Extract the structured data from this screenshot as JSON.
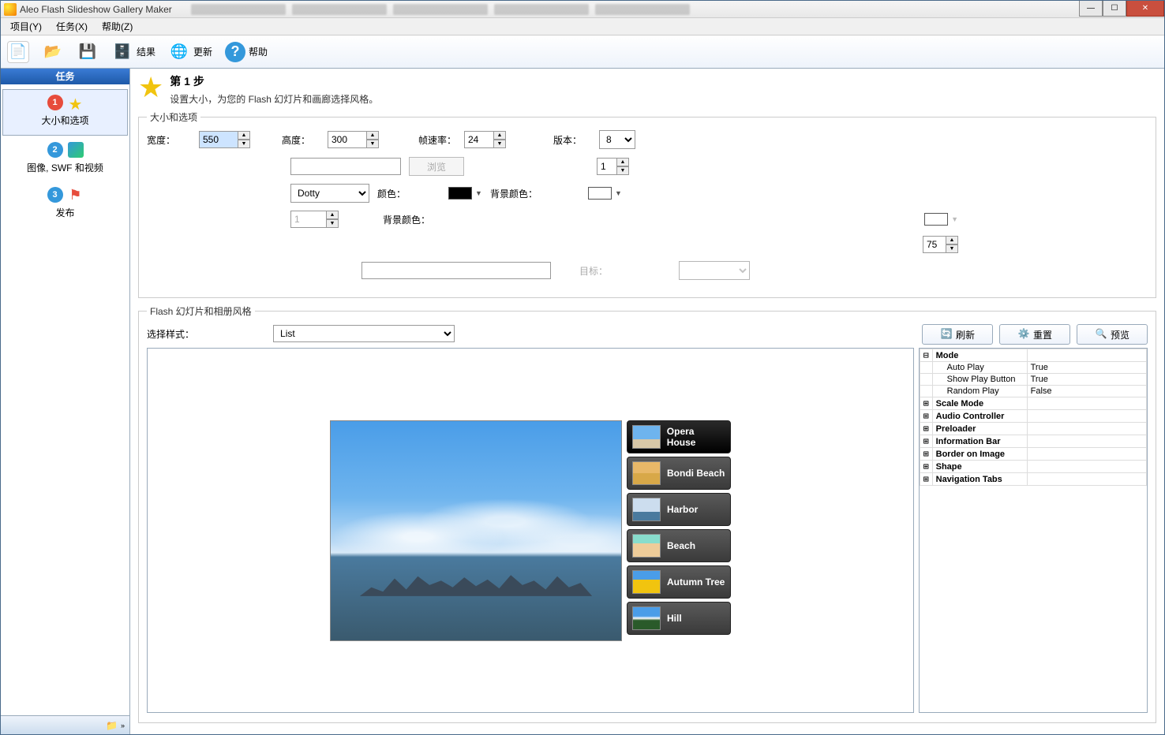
{
  "window": {
    "title": "Aleo Flash Slideshow Gallery Maker"
  },
  "menu": {
    "project": "项目(Y)",
    "task": "任务(X)",
    "help": "帮助(Z)"
  },
  "toolbar": {
    "result": "结果",
    "update": "更新",
    "help": "帮助"
  },
  "sidebar": {
    "header": "任务",
    "items": [
      {
        "label": "大小和选项"
      },
      {
        "label": "图像, SWF 和视频"
      },
      {
        "label": "发布"
      }
    ]
  },
  "step": {
    "title": "第 1 步",
    "desc": "设置大小，为您的 Flash 幻灯片和画廊选择风格。"
  },
  "size_group": {
    "legend": "大小和选项",
    "width_label": "宽度：",
    "width": "550",
    "height_label": "高度：",
    "height": "300",
    "fps_label": "帧速率：",
    "fps": "24",
    "version_label": "版本：",
    "version": "8",
    "browse": "浏览",
    "one_a": "1",
    "preset": "Dotty",
    "color_label": "颜色：",
    "bgcolor_label": "背景颜色：",
    "one_b": "1",
    "bgcolor2_label": "背景颜色：",
    "seventyfive": "75",
    "target_label": "目标："
  },
  "style_group": {
    "legend": "Flash 幻灯片和相册风格",
    "style_label": "选择样式：",
    "style_value": "List"
  },
  "actions": {
    "refresh": "刷新",
    "reset": "重置",
    "preview": "预览"
  },
  "thumbs": [
    {
      "label": "Opera House"
    },
    {
      "label": "Bondi Beach"
    },
    {
      "label": "Harbor"
    },
    {
      "label": "Beach"
    },
    {
      "label": "Autumn Tree"
    },
    {
      "label": "Hill"
    }
  ],
  "props": {
    "mode": {
      "name": "Mode",
      "auto_play": {
        "k": "Auto Play",
        "v": "True"
      },
      "show_play": {
        "k": "Show Play Button",
        "v": "True"
      },
      "random": {
        "k": "Random Play",
        "v": "False"
      }
    },
    "scale": "Scale Mode",
    "audio": "Audio Controller",
    "preloader": "Preloader",
    "info": "Information Bar",
    "border": "Border on Image",
    "shape": "Shape",
    "nav": "Navigation Tabs"
  }
}
